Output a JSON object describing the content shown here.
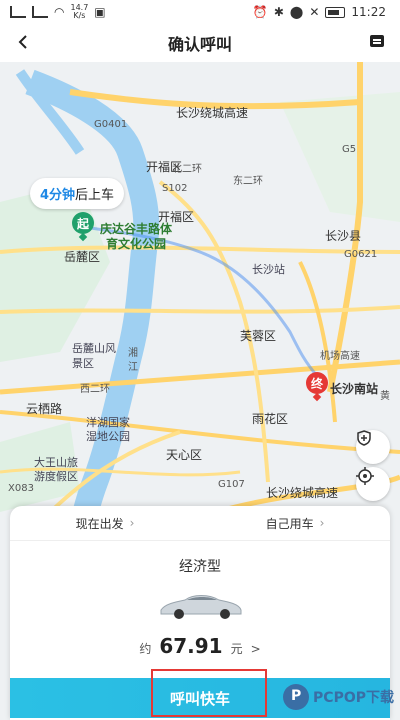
{
  "status_bar": {
    "net_speed_value": "14.7",
    "net_speed_unit": "K/s",
    "time": "11:22"
  },
  "header": {
    "title": "确认呼叫",
    "back_icon": "chevron-left-icon",
    "message_icon": "message-icon"
  },
  "map": {
    "pickup_bubble": {
      "time": "4分钟",
      "suffix": "后上车"
    },
    "start_marker": "起",
    "end_marker": "终",
    "start_name_line1": "庆达谷丰路体",
    "start_name_line2": "育文化公园",
    "end_name": "长沙南站",
    "labels": {
      "kaifu": "开福区",
      "yuelu": "岳麓区",
      "changsha_county": "长沙县",
      "furong": "芙蓉区",
      "changsha_station": "长沙站",
      "yuhua": "雨花区",
      "tianxin": "天心区",
      "yunqi": "云栖路",
      "yuelushan": "岳麓山风",
      "jingqu": "景区",
      "yanghu": "洋湖国家",
      "shidi": "湿地公园",
      "dawang": "大王山旅",
      "dawang2": "游度假区",
      "xiang": "湘",
      "jiang": "江",
      "xiangjiang": "湘江",
      "changsha_ring": "长沙绕城高速",
      "changsha_ring2": "长沙绕城高速",
      "beiyihuan": "北二环",
      "dongerhuan": "东二环",
      "erhuan": "二环",
      "xierhuan": "西二环",
      "airport": "机场高速",
      "huang": "黄",
      "g0401": "G0401",
      "s102": "S102",
      "g5": "G5",
      "g0621": "G0621",
      "g107": "G107",
      "x083": "X083",
      "s61": "S61",
      "g_right": "G",
      "jinggang": "京港澳高速"
    }
  },
  "panel": {
    "tabs": [
      {
        "label": "现在出发"
      },
      {
        "label": "自己用车"
      }
    ],
    "car_type": "经济型",
    "price_prefix": "约",
    "price": "67.91",
    "price_unit": "元",
    "price_chevron": ">",
    "cta": "呼叫快车"
  },
  "watermark": {
    "text": "PCPOP下载"
  }
}
